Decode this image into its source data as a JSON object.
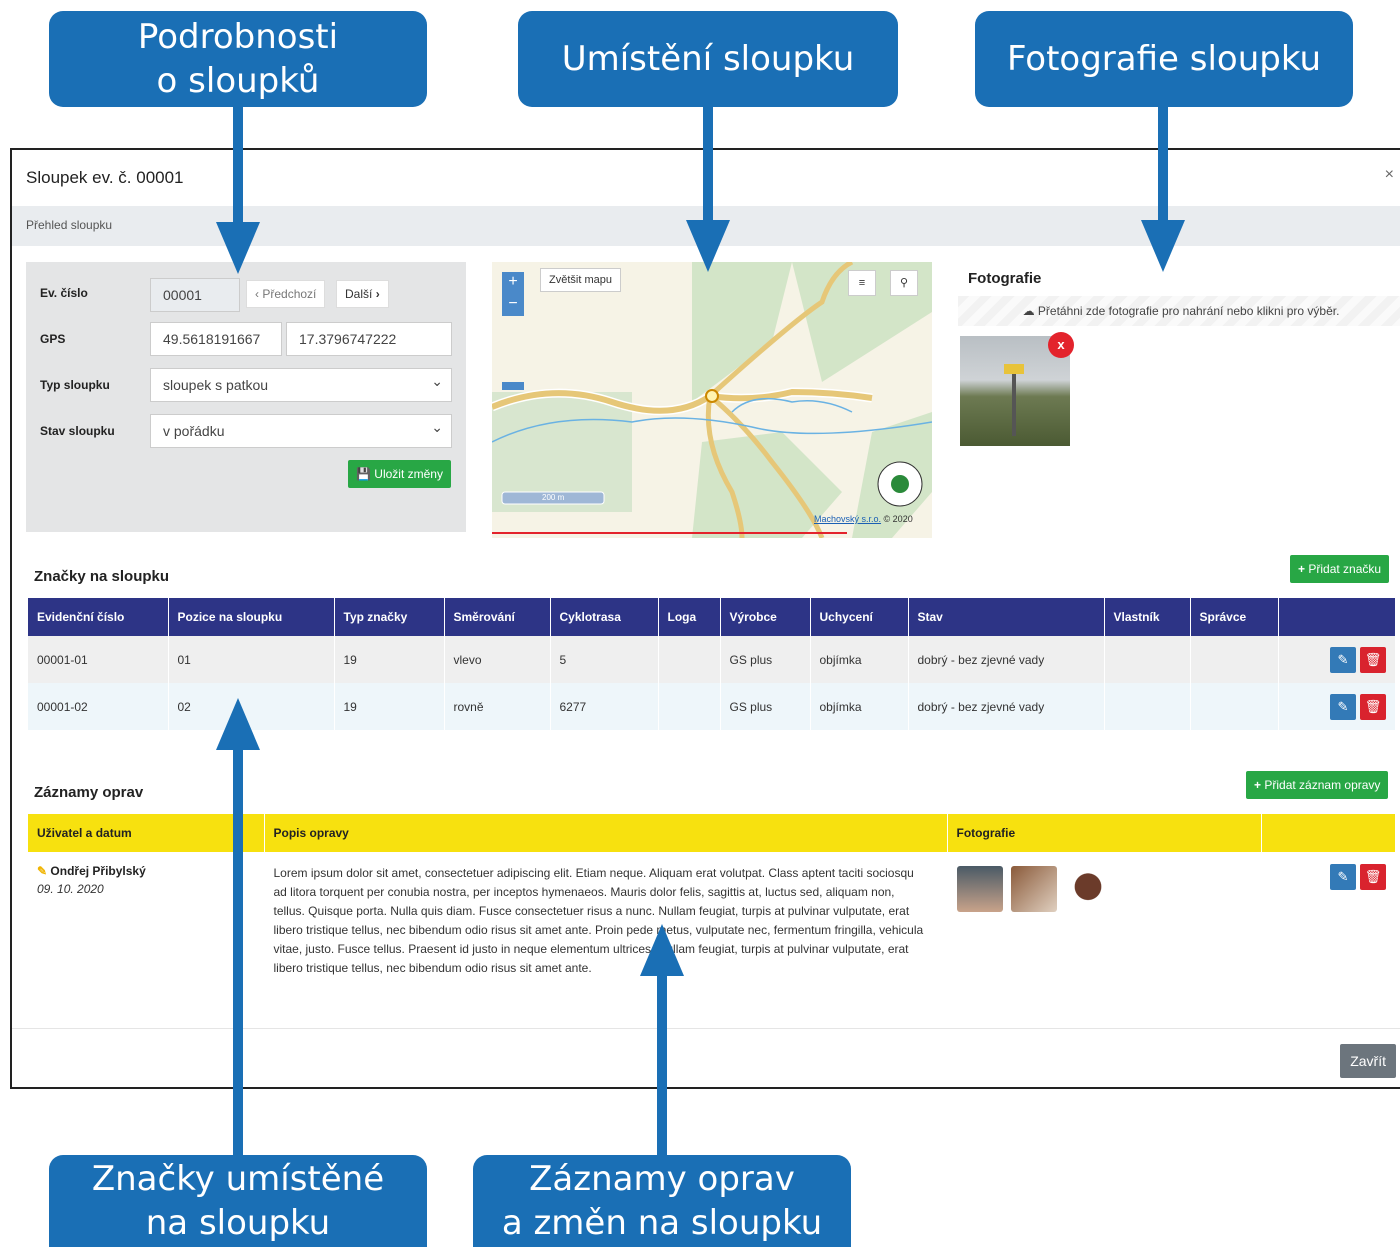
{
  "callouts": {
    "details": [
      "Podrobnosti",
      "o sloupků"
    ],
    "location": "Umístění sloupku",
    "photo": "Fotografie sloupku",
    "signs": [
      "Značky umístěné",
      "na sloupku"
    ],
    "repairs": [
      "Záznamy oprav",
      "a změn na sloupku"
    ]
  },
  "modal": {
    "title": "Sloupek ev. č. 00001",
    "close": "×",
    "subtitle": "Přehled sloupku",
    "close_button": "Zavřít"
  },
  "form": {
    "ev_label": "Ev. číslo",
    "ev_value": "00001",
    "prev_label": "Předchozí",
    "next_label": "Další",
    "gps_label": "GPS",
    "gps_lat": "49.5618191667",
    "gps_lon": "17.3796747222",
    "type_label": "Typ sloupku",
    "type_value": "sloupek s patkou",
    "state_label": "Stav sloupku",
    "state_value": "v pořádku",
    "save_label": "Uložit změny"
  },
  "map": {
    "enlarge": "Zvětšit mapu",
    "zoom_in": "+",
    "zoom_out": "−",
    "scale": "200 m",
    "attribution_link": "Machovský s.r.o.",
    "attribution_year": "© 2020"
  },
  "photos": {
    "title": "Fotografie",
    "dropzone": "Přetáhni zde fotografie pro nahrání nebo klikni pro výběr.",
    "delete": "x"
  },
  "signs": {
    "title": "Značky na sloupku",
    "add_label": "Přidat značku",
    "columns": [
      "Evidenční číslo",
      "Pozice na sloupku",
      "Typ značky",
      "Směrování",
      "Cyklotrasa",
      "Loga",
      "Výrobce",
      "Uchycení",
      "Stav",
      "Vlastník",
      "Správce",
      ""
    ],
    "rows": [
      [
        "00001-01",
        "01",
        "19",
        "vlevo",
        "5",
        "",
        "GS plus",
        "objímka",
        "dobrý - bez zjevné vady",
        "",
        ""
      ],
      [
        "00001-02",
        "02",
        "19",
        "rovně",
        "6277",
        "",
        "GS plus",
        "objímka",
        "dobrý - bez zjevné vady",
        "",
        ""
      ]
    ]
  },
  "repairs": {
    "title": "Záznamy oprav",
    "add_label": "Přidat záznam opravy",
    "columns": [
      "Uživatel a datum",
      "Popis opravy",
      "Fotografie",
      ""
    ],
    "rows": [
      {
        "user": "Ondřej Přibylský",
        "date": "09. 10. 2020",
        "description": "Lorem ipsum dolor sit amet, consectetuer adipiscing elit. Etiam neque. Aliquam erat volutpat. Class aptent taciti sociosqu ad litora torquent per conubia nostra, per inceptos hymenaeos. Mauris dolor felis, sagittis at, luctus sed, aliquam non, tellus. Quisque porta. Nulla quis diam. Fusce consectetuer risus a nunc. Nullam feugiat, turpis at pulvinar vulputate, erat libero tristique tellus, nec bibendum odio risus sit amet ante. Proin pede metus, vulputate nec, fermentum fringilla, vehicula vitae, justo. Fusce tellus. Praesent id justo in neque elementum ultrices. Nullam feugiat, turpis at pulvinar vulputate, erat libero tristique tellus, nec bibendum odio risus sit amet ante."
      }
    ]
  },
  "colors": {
    "callout": "#1a6fb5",
    "signs_header": "#2d3486",
    "repairs_header": "#f7e10f",
    "success": "#28a745",
    "danger": "#d9232e",
    "primary": "#337ab7"
  }
}
